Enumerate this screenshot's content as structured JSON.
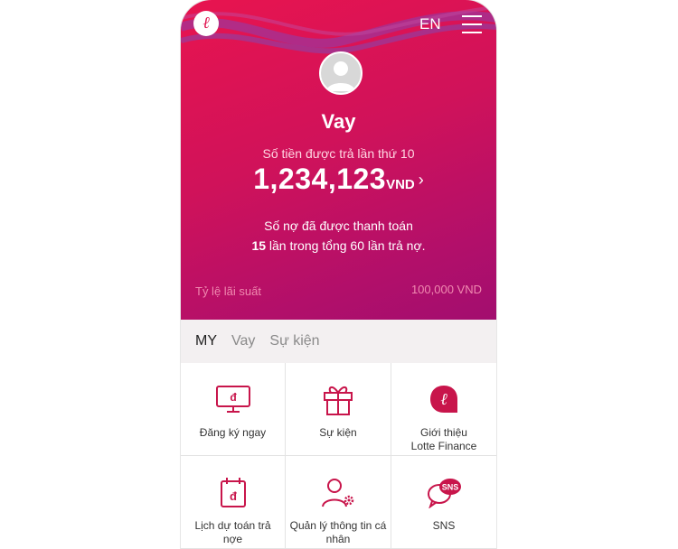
{
  "header": {
    "logo_letter": "ℓ",
    "language": "EN"
  },
  "hero": {
    "title": "Vay",
    "payment_label": "Số tiền được trả lần thứ 10",
    "amount": "1,234,123",
    "currency": "VND",
    "paid_line1": "Số nợ đã được thanh toán",
    "paid_count": "15",
    "paid_line2_rest": " lần trong tổng 60 lần trả nợ.",
    "rate_label": "Tỷ lệ lãi suất",
    "rate_value": "100,000 VND"
  },
  "tabs": [
    {
      "label": "MY",
      "active": true
    },
    {
      "label": "Vay",
      "active": false
    },
    {
      "label": "Sự kiện",
      "active": false
    }
  ],
  "grid": {
    "items": [
      {
        "label": "Đăng ký ngay",
        "icon": "monitor-dong-icon"
      },
      {
        "label": "Sự kiện",
        "icon": "gift-icon"
      },
      {
        "label": "Giới thiệu Lotte Finance",
        "icon": "lotte-logo-icon"
      },
      {
        "label": "Lịch dự toán trả nợe",
        "icon": "calendar-dong-icon"
      },
      {
        "label": "Quản lý thông tin cá nhân",
        "icon": "user-settings-icon"
      },
      {
        "label": "SNS",
        "icon": "sns-bubbles-icon",
        "badge": "SNS"
      }
    ]
  },
  "colors": {
    "brand": "#e0134f",
    "hero_start": "#e8144f",
    "hero_end": "#a20e6f",
    "icon": "#c8154b"
  }
}
